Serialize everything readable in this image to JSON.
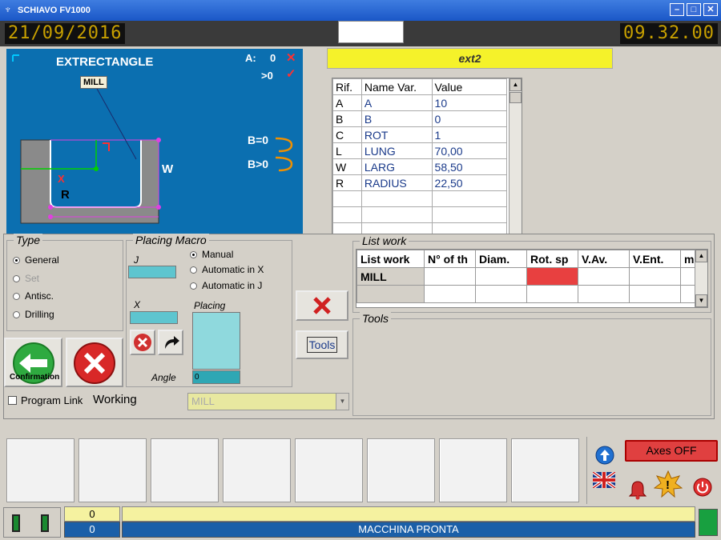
{
  "window": {
    "title": "SCHIAVO FV1000"
  },
  "header": {
    "date": "21/09/2016",
    "time": "09.32.00"
  },
  "preview": {
    "title": "EXTRECTANGLE",
    "tool_tag": "MILL",
    "label_a": "A:",
    "label_a_val": "0",
    "label_gt0": ">0",
    "label_b0": "B=0",
    "label_bgt0": "B>0",
    "label_w": "W",
    "label_r": "R",
    "label_x": "X"
  },
  "program": {
    "name": "ext2"
  },
  "variables": {
    "columns": [
      "Rif.",
      "Name Var.",
      "Value"
    ],
    "rows": [
      {
        "ref": "A",
        "name": "A",
        "value": "10"
      },
      {
        "ref": "B",
        "name": "B",
        "value": "0"
      },
      {
        "ref": "C",
        "name": "ROT",
        "value": "1"
      },
      {
        "ref": "L",
        "name": "LUNG",
        "value": "70,00"
      },
      {
        "ref": "W",
        "name": "LARG",
        "value": "58,50"
      },
      {
        "ref": "R",
        "name": "RADIUS",
        "value": "22,50"
      }
    ]
  },
  "type_group": {
    "title": "Type",
    "options": [
      {
        "label": "General",
        "selected": true,
        "enabled": true
      },
      {
        "label": "Set",
        "selected": false,
        "enabled": false
      },
      {
        "label": "Antisc.",
        "selected": false,
        "enabled": true
      },
      {
        "label": "Drilling",
        "selected": false,
        "enabled": true
      }
    ]
  },
  "placing_macro": {
    "title": "Placing Macro",
    "j_label": "J",
    "x_label": "X",
    "placing_label": "Placing",
    "angle_label": "Angle",
    "angle_value": "0",
    "modes": [
      {
        "label": "Manual",
        "selected": true
      },
      {
        "label": "Automatic in X",
        "selected": false
      },
      {
        "label": "Automatic in J",
        "selected": false
      }
    ]
  },
  "buttons": {
    "confirmation": "Confirmation",
    "tools": "Tools"
  },
  "program_link": {
    "label": "Program Link",
    "checked": false
  },
  "working": {
    "label": "Working",
    "value": "MILL"
  },
  "list_work": {
    "title": "List work",
    "columns": [
      "List work",
      "N° of th",
      "Diam.",
      "Rot. sp",
      "V.Av.",
      "V.Ent.",
      "m"
    ],
    "rows": [
      [
        "MILL",
        "",
        "",
        "",
        "",
        "",
        ""
      ],
      [
        "",
        "",
        "",
        "",
        "",
        "",
        ""
      ]
    ],
    "highlight_color": "#e84040"
  },
  "tools_group": {
    "title": "Tools"
  },
  "controls": {
    "axes": "Axes OFF"
  },
  "status": {
    "counter_top": "0",
    "counter_bottom": "0",
    "message": "MACCHINA PRONTA"
  }
}
